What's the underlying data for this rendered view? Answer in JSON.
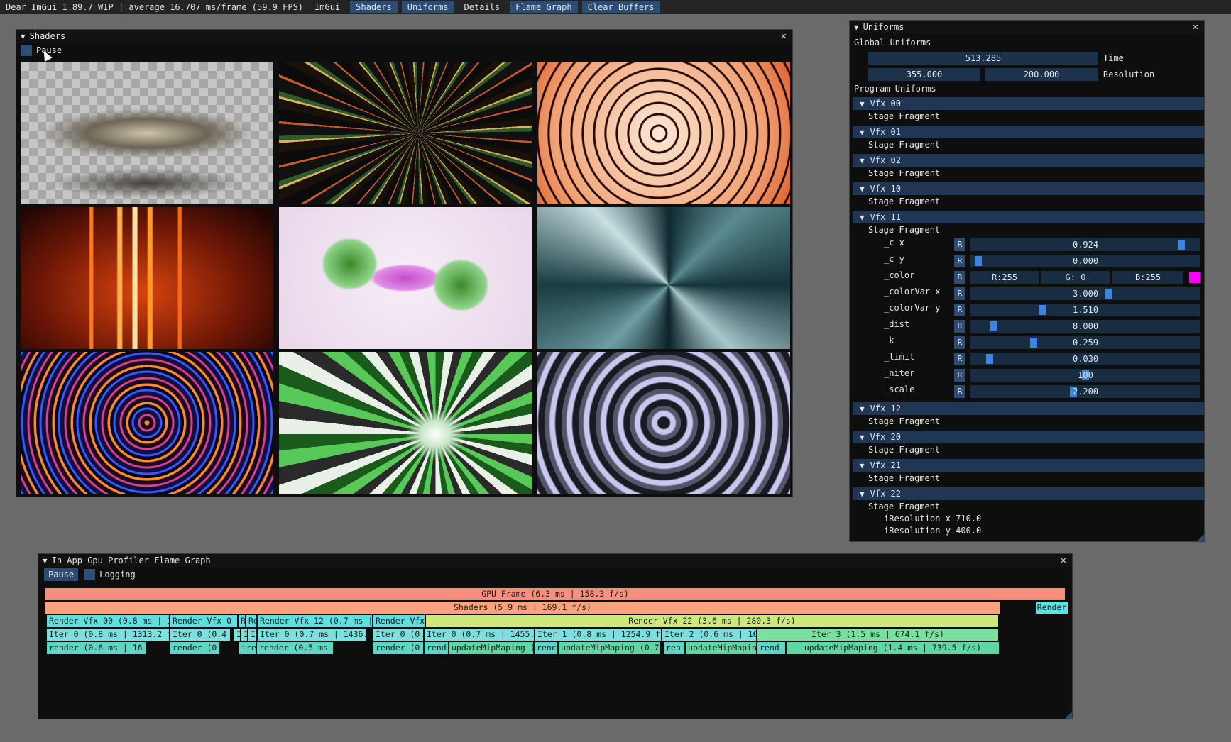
{
  "menubar": {
    "title": "Dear ImGui 1.89.7 WIP | average 16.707 ms/frame (59.9 FPS)",
    "items": [
      {
        "label": "ImGui",
        "active": false
      },
      {
        "label": "Shaders",
        "active": true
      },
      {
        "label": "Uniforms",
        "active": true
      },
      {
        "label": "Details",
        "active": false
      },
      {
        "label": "Flame Graph",
        "active": true
      },
      {
        "label": "Clear Buffers",
        "active": true
      }
    ]
  },
  "shaders_window": {
    "title": "Shaders",
    "pause_label": "Pause"
  },
  "uniforms_window": {
    "title": "Uniforms",
    "global_label": "Global Uniforms",
    "time_value": "513.285",
    "time_label": "Time",
    "res_x": "355.000",
    "res_y": "200.000",
    "res_label": "Resolution",
    "program_label": "Program Uniforms",
    "stage_label": "Stage Fragment",
    "headers": [
      "Vfx 00",
      "Vfx 01",
      "Vfx 02",
      "Vfx 10",
      "Vfx 11",
      "Vfx 12",
      "Vfx 20",
      "Vfx 21",
      "Vfx 22"
    ],
    "reset_label": "R",
    "vfx11": {
      "c_x": {
        "label": "_c x",
        "value": "0.924"
      },
      "c_y": {
        "label": "_c y",
        "value": "0.000"
      },
      "color": {
        "label": "_color",
        "r": "R:255",
        "g": "G:  0",
        "b": "B:255",
        "swatch": "#ff00ff"
      },
      "colorVar_x": {
        "label": "_colorVar x",
        "value": "3.000"
      },
      "colorVar_y": {
        "label": "_colorVar y",
        "value": "1.510"
      },
      "dist": {
        "label": "_dist",
        "value": "8.000"
      },
      "k": {
        "label": "_k",
        "value": "0.259"
      },
      "limit": {
        "label": "_limit",
        "value": "0.030"
      },
      "niter": {
        "label": "_niter",
        "value": "100"
      },
      "scale": {
        "label": "_scale",
        "value": "2.200"
      }
    },
    "vfx22": {
      "ires_x": "iResolution x 710.0",
      "ires_y": "iResolution y 400.0"
    }
  },
  "flame_window": {
    "title": "In App Gpu Profiler Flame Graph",
    "pause_label": "Pause",
    "logging_label": "Logging",
    "bars": {
      "gpu_frame": "GPU Frame (6.3 ms | 158.3 f/s)",
      "shaders": "Shaders (5.9 ms | 169.1 f/s)",
      "render_right": "Render",
      "render_vfx00": "Render Vfx 00 (0.8 ms | 1",
      "render_vfx0x": "Render Vfx 0",
      "render_r": "R",
      "render_re": "Re",
      "render_vfx12": "Render Vfx 12 (0.7 ms | 1",
      "render_vfx_b": "Render Vfx",
      "render_vfx22": "Render Vfx 22 (3.6 ms | 280.3 f/s)",
      "iter0_a": "Iter 0 (0.8 ms | 1313.2 f",
      "iter0_b": "Iter 0 (0.4",
      "iter_i1": "I",
      "iter_i2": "I",
      "iter_ii": "II",
      "iter0_c": "Iter 0 (0.7 ms | 1436.",
      "iter0_d": "Iter 0 (0.",
      "iter0_e": "Iter 0 (0.7 ms | 1455.",
      "iter1": "Iter 1 (0.8 ms | 1254.9 f",
      "iter2": "Iter 2 (0.6 ms | 16",
      "iter3": "Iter 3 (1.5 ms | 674.1 f/s)",
      "render_a": "render (0.6 ms | 16",
      "render_b": "render (0.",
      "render_ire": "ire",
      "render_c": "render (0.5 ms",
      "render_d": "render (0",
      "rend_1": "rend",
      "upd_1": "updateMipMaping (0",
      "renc": "renc",
      "upd_2": "updateMipMaping (0.7",
      "ren": "ren",
      "upd_3": "updateMipMapin",
      "rend_2": "rend",
      "upd_4": "updateMipMaping (1.4 ms | 739.5 f/s)"
    },
    "colors": {
      "gpu_frame": "#f98e7e",
      "shaders": "#f9a27e",
      "render": "#5de0e0",
      "render_vfx22": "#cfe87a",
      "iter": "#7fdfdf",
      "iter3": "#7ae0a0",
      "update": "#5ed6a6"
    }
  }
}
